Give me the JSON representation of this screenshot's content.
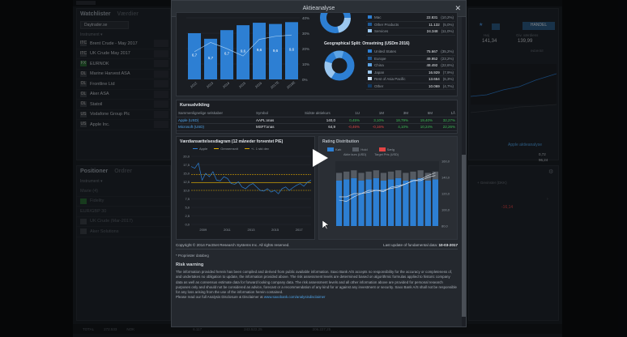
{
  "app": {
    "watchlist_tab": "Watchlister",
    "watchlist_tab2": "Værdier",
    "watchlist_dropdown": "Daytrader.se",
    "watchlist_subheader": "Instrument ▾",
    "watchlist_items": [
      {
        "badge": "ITC",
        "name": "Brent Crude - May 2017"
      },
      {
        "badge": "ITC",
        "name": "UK Crude May 2017"
      },
      {
        "badge": "FX",
        "name": "EURNOK"
      },
      {
        "badge": "OL",
        "name": "Marine Harvest ASA"
      },
      {
        "badge": "OL",
        "name": "Frontline Ltd"
      },
      {
        "badge": "OL",
        "name": "Aker ASA"
      },
      {
        "badge": "OL",
        "name": "Statoil"
      },
      {
        "badge": "US",
        "name": "Vodafone Group Plc"
      },
      {
        "badge": "US",
        "name": "Apple Inc."
      }
    ],
    "positions_tab": "Positioner",
    "positions_tab2": "Ordrer",
    "positions_subheader": "Instrument ▾",
    "positions_items": [
      "Marie (4)",
      "Fidelity",
      "EUR/GBP 30",
      "UK Crude (Mar-2017)",
      "Aker Solutions"
    ],
    "right_stats": {
      "label1": "Høj",
      "value1": "141,34",
      "label2": "Giv. værdiens",
      "value2": "139,99"
    },
    "right_button": "HANDEL",
    "right_small_label": "INDIKSE",
    "right_link": "Apple aktieanalyse",
    "right_values": [
      "0,72",
      "139,19",
      "96,24",
      "90,34"
    ],
    "right_col_header": "+ Gevinster (DKK)",
    "right_red_value": "-16,14",
    "footer_left": [
      "TOTAL",
      "272.533",
      "NOK"
    ],
    "footer_values": [
      "6.117",
      "243.522,25",
      "206.227,25",
      "206.227,25"
    ]
  },
  "modal": {
    "title": "Aktieanalyse",
    "revenue_chart": {
      "years": [
        "2012",
        "2013",
        "2014",
        "2015",
        "2016",
        "2017E",
        "2018E"
      ],
      "bar_labels": [
        "6,7",
        "5,7",
        "6,7",
        "9,6",
        "9,6",
        "9,6",
        "9,6"
      ],
      "right_axis": [
        "40%",
        "30%",
        "20%",
        "10%",
        "0%"
      ]
    },
    "revenue_breakdown": [
      {
        "label": "Mac",
        "value": "22.831",
        "pct": "(10,2%)"
      },
      {
        "label": "Other Products",
        "value": "11.132",
        "pct": "(5,0%)"
      },
      {
        "label": "Services",
        "value": "24.348",
        "pct": "(11,0%)"
      }
    ],
    "geo_title": "Geographical Split: Omsetning (USDm 2016)",
    "geo_breakdown": [
      {
        "label": "United States",
        "value": "75.667",
        "pct": "(35,2%)"
      },
      {
        "label": "Europe",
        "value": "49.952",
        "pct": "(23,2%)"
      },
      {
        "label": "China",
        "value": "48.492",
        "pct": "(22,6%)"
      },
      {
        "label": "Japan",
        "value": "16.929",
        "pct": "(7,9%)"
      },
      {
        "label": "Rest of Asia Pacific",
        "value": "13.654",
        "pct": "(6,3%)"
      },
      {
        "label": "Other",
        "value": "10.069",
        "pct": "(4,7%)"
      }
    ],
    "perf": {
      "title": "Kursudvikling",
      "headers": [
        "Sammenlignelige selskaber",
        "Symbol",
        "Sidste aktiekurs",
        "1U",
        "1M",
        "3M",
        "6M",
        "1Å"
      ],
      "rows": [
        {
          "name": "Apple (USD)",
          "symbol": "AAPL:xnas",
          "price": "140,0",
          "c1": "0,45%",
          "c2": "3,10%",
          "c3": "18,79%",
          "c4": "19,40%",
          "c5": "32,27%"
        },
        {
          "name": "Microsoft (USD)",
          "symbol": "MSFT:xnas",
          "price": "64,9",
          "c1": "-0,46%",
          "c2": "-0,16%",
          "c3": "4,10%",
          "c4": "10,24%",
          "c5": "22,26%"
        }
      ]
    },
    "pe_chart": {
      "title": "Værdiansættelsesdiagram (12 måneder forventet P/E)",
      "legend": [
        "Apple",
        "Gennemsnit",
        "+/- 1 std dev"
      ],
      "y_ticks": [
        "20,0",
        "17,5",
        "15,0",
        "12,5",
        "10,0",
        "7,5",
        "5,0",
        "2,5",
        "0,0"
      ],
      "x_ticks": [
        "2009",
        "2011",
        "2013",
        "2015",
        "2017"
      ]
    },
    "rating_chart": {
      "title": "Rating Distribution",
      "legend": [
        "Køb",
        "Hold",
        "Sælg"
      ],
      "sub_legend": [
        "Aktie kurs (USD)",
        "Target Pris (USD)"
      ],
      "y_ticks": [
        "160,0",
        "140,0",
        "120,0",
        "100,0",
        "80,0"
      ]
    },
    "copyright": "Copyright © 2014 FactSet Research Systems Inc. All rights reserved.",
    "last_update_label": "Last update of fundamental data:",
    "last_update_value": "10-03-2017",
    "proprietary": "* Proprietær databeg",
    "risk_title": "Risk warning",
    "risk_text": "The information provided herein has been compiled and derived from public available information. Saxo Bank A/S accepts no responsibility for the accuracy or completeness of, and undertakes no obligation to update, the information provided above. The risk assessment levels are determined based on algorithmic formulas applied to historic company data as well as consensus estimate data for forward looking company data. The risk assessment levels and all other information above are provided for personal research purposes only and should not be considered as advice, forecast or a recommendation of any kind for or against any investment or security. Saxo Bank A/S shall not be responsible for any loss arising from the use of the information herein contained.",
    "risk_link_prefix": "Please read our full Analysis Disclosure & Disclaimer at",
    "risk_link": "www.saxobank.com/analysisdisclaimer"
  },
  "colors": {
    "accent_blue": "#2d7fd3",
    "positive": "#3dbb55",
    "negative": "#e24444",
    "mean_line": "#e8b400",
    "std_line": "#d6a200"
  }
}
